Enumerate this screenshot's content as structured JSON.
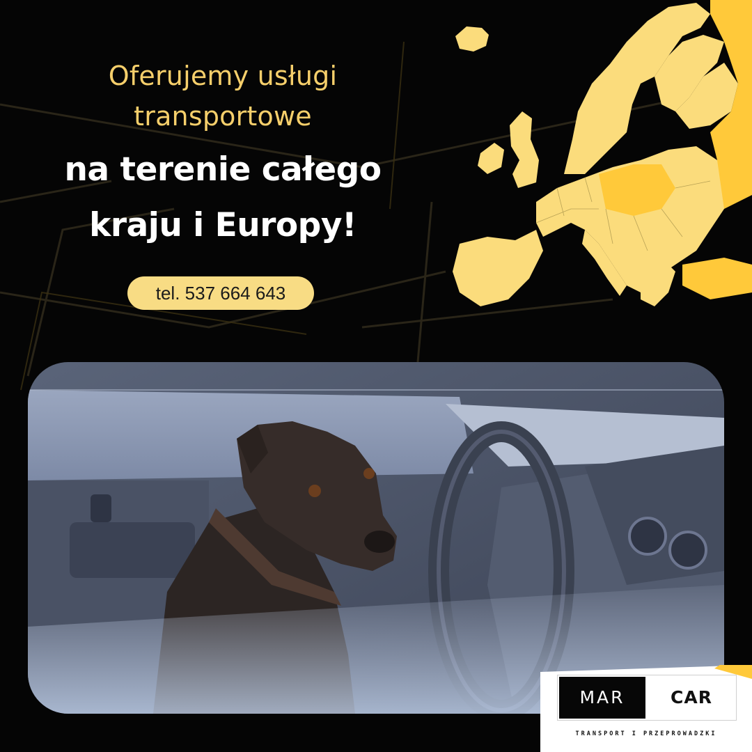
{
  "headline": {
    "line1": "Oferujemy usługi",
    "line2": "transportowe",
    "line3": "na terenie całego",
    "line4": "kraju i Europy!"
  },
  "contact": {
    "phone": "tel. 537 664 643"
  },
  "logo": {
    "left_word": "MAR",
    "right_word": "CAR",
    "tagline": "TRANSPORT I PRZEPROWADZKI"
  },
  "colors": {
    "background": "#050505",
    "accent_yellow": "#f6cf6b",
    "map_light": "#fbdc7c",
    "map_bright": "#ffc93a",
    "headline_white": "#ffffff"
  },
  "icons": {
    "map": "europe-map",
    "photo": "dog-in-car-photo"
  }
}
